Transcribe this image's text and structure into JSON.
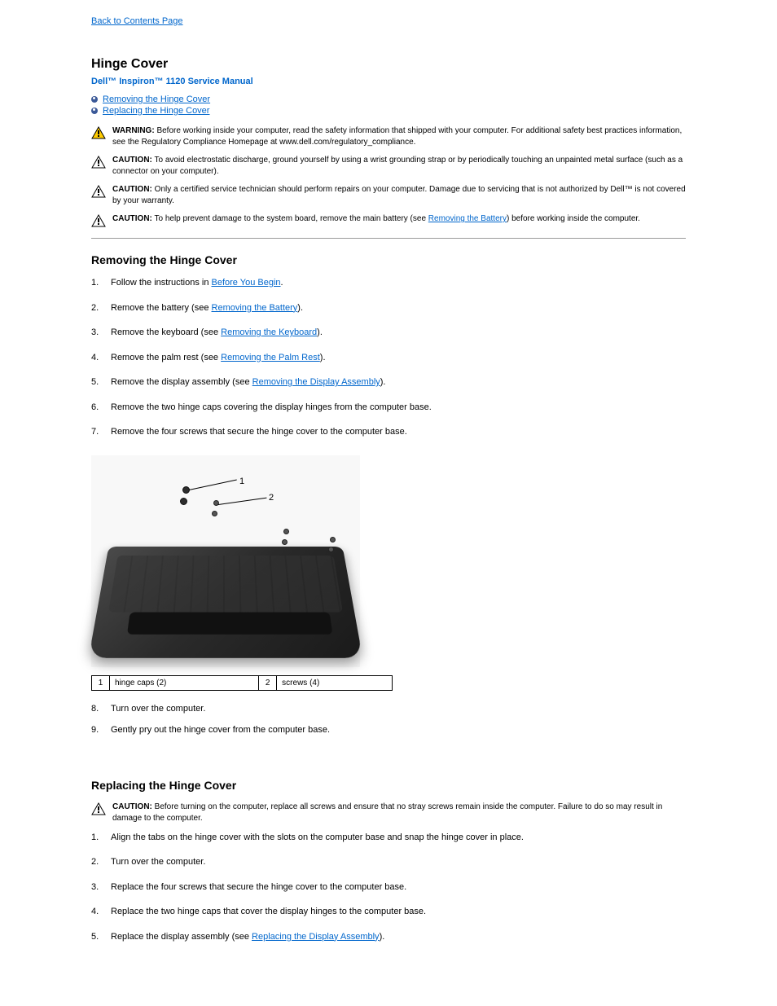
{
  "back_link": "Back to Contents Page",
  "page_title": "Hinge Cover",
  "manual_title": "Dell™ Inspiron™ 1120 Service Manual",
  "toc": [
    {
      "label": "Removing the Hinge Cover"
    },
    {
      "label": "Replacing the Hinge Cover"
    }
  ],
  "callouts": [
    {
      "type": "warning",
      "prefix": "WARNING:",
      "text": "Before working inside your computer, read the safety information that shipped with your computer. For additional safety best practices information, see the Regulatory Compliance Homepage at www.dell.com/regulatory_compliance."
    },
    {
      "type": "caution",
      "prefix": "CAUTION:",
      "text": "To avoid electrostatic discharge, ground yourself by using a wrist grounding strap or by periodically touching an unpainted metal surface (such as a connector on your computer)."
    },
    {
      "type": "caution",
      "prefix": "CAUTION:",
      "text": "Only a certified service technician should perform repairs on your computer. Damage due to servicing that is not authorized by Dell™ is not covered by your warranty."
    },
    {
      "type": "caution",
      "prefix": "CAUTION:",
      "text_before": "To help prevent damage to the system board, remove the main battery (see ",
      "link": "Removing the Battery",
      "text_after": ") before working inside the computer."
    }
  ],
  "remove": {
    "title": "Removing the Hinge Cover",
    "steps": [
      {
        "text_before": "Follow the instructions in ",
        "link": "Before You Begin",
        "text_after": "."
      },
      {
        "text_before": "Remove the battery (see ",
        "link": "Removing the Battery",
        "text_after": ")."
      },
      {
        "text_before": "Remove the keyboard (see ",
        "link": "Removing the Keyboard",
        "text_after": ")."
      },
      {
        "text_before": "Remove the palm rest (see ",
        "link": "Removing the Palm Rest",
        "text_after": ")."
      },
      {
        "text_before": "Remove the display assembly (see ",
        "link": "Removing the Display Assembly",
        "text_after": ")."
      },
      {
        "text": "Remove the two hinge caps covering the display hinges from the computer base."
      },
      {
        "text": "Remove the four screws that secure the hinge cover to the computer base."
      }
    ]
  },
  "parts_table": [
    {
      "num": "1",
      "label": "hinge caps (2)",
      "num2": "2",
      "label2": "screws (4)"
    }
  ],
  "remove_steps_after": [
    {
      "num": "8.",
      "text": "Turn over the computer."
    },
    {
      "num": "9.",
      "text": "Gently pry out the hinge cover from the computer base."
    }
  ],
  "replace": {
    "title": "Replacing the Hinge Cover",
    "caution": {
      "prefix": "CAUTION:",
      "text": "Before turning on the computer, replace all screws and ensure that no stray screws remain inside the computer. Failure to do so may result in damage to the computer."
    },
    "steps": [
      {
        "text": "Align the tabs on the hinge cover with the slots on the computer base and snap the hinge cover in place."
      },
      {
        "text": "Turn over the computer."
      },
      {
        "text": "Replace the four screws that secure the hinge cover to the computer base."
      },
      {
        "text": "Replace the two hinge caps that cover the display hinges to the computer base."
      },
      {
        "text_before": "Replace the display assembly (see ",
        "link": "Replacing the Display Assembly",
        "text_after": ")."
      }
    ]
  }
}
